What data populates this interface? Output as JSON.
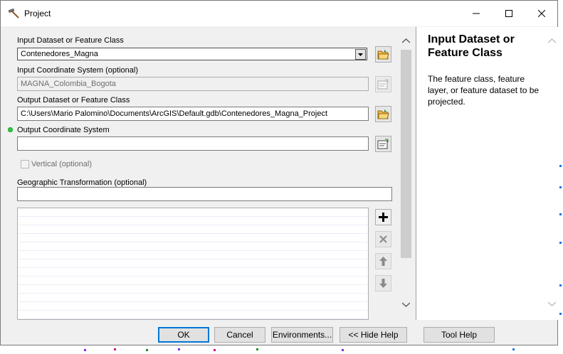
{
  "window": {
    "title": "Project"
  },
  "params": {
    "input_dataset": {
      "label": "Input Dataset or Feature Class",
      "value": "Contenedores_Magna"
    },
    "input_cs": {
      "label": "Input Coordinate System (optional)",
      "value": "MAGNA_Colombia_Bogota"
    },
    "output_dataset": {
      "label": "Output Dataset or Feature Class",
      "value": "C:\\Users\\Mario Palomino\\Documents\\ArcGIS\\Default.gdb\\Contenedores_Magna_Project"
    },
    "output_cs": {
      "label": "Output Coordinate System",
      "value": ""
    },
    "vertical": {
      "label": "Vertical (optional)",
      "checked": false
    },
    "geo_transform": {
      "label": "Geographic Transformation (optional)",
      "value": ""
    }
  },
  "help": {
    "title": "Input Dataset or Feature Class",
    "body": "The feature class, feature layer, or feature dataset to be projected."
  },
  "buttons": {
    "ok": "OK",
    "cancel": "Cancel",
    "environments": "Environments...",
    "hide_help": "<< Hide Help",
    "tool_help": "Tool Help"
  },
  "colors": {
    "required_dot": "#2ecc40",
    "default_button_border": "#0078d7"
  },
  "icons": [
    "hammer-icon",
    "minimize-icon",
    "maximize-icon",
    "close-icon",
    "open-folder-icon",
    "coordinate-properties-icon",
    "add-icon",
    "remove-icon",
    "up-arrow-icon",
    "down-arrow-icon"
  ]
}
